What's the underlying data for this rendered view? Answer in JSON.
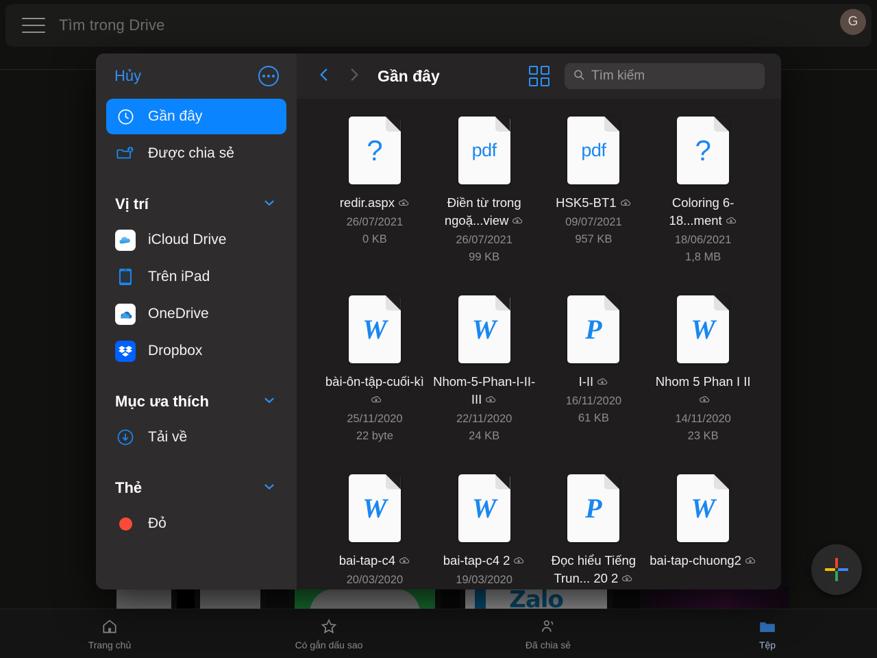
{
  "drive": {
    "search_placeholder": "Tìm trong Drive",
    "menu_icon": "hamburger-icon",
    "avatar_initial": "G",
    "fab_icon": "plus-icon",
    "tabs": [
      {
        "label": "Trang chủ",
        "icon": "home-icon",
        "active": false
      },
      {
        "label": "Có gắn dấu sao",
        "icon": "star-icon",
        "active": false
      },
      {
        "label": "Đã chia sẻ",
        "icon": "people-icon",
        "active": false
      },
      {
        "label": "Tệp",
        "icon": "folder-icon",
        "active": true
      }
    ]
  },
  "picker": {
    "cancel_label": "Hủy",
    "more_icon": "ellipsis-circle-icon",
    "nav": {
      "back_icon": "chevron-left-icon",
      "forward_icon": "chevron-right-icon",
      "breadcrumb": "Gần đây",
      "grid_icon": "grid-view-icon",
      "search_icon": "search-icon",
      "search_placeholder": "Tìm kiếm"
    },
    "sidebar": {
      "items": [
        {
          "label": "Gần đây",
          "icon": "clock-icon",
          "selected": true
        },
        {
          "label": "Được chia sẻ",
          "icon": "shared-folder-icon",
          "selected": false
        }
      ],
      "sections": [
        {
          "title": "Vị trí",
          "chevron": "chevron-down-icon",
          "items": [
            {
              "label": "iCloud Drive",
              "icon": "icloud-drive-icon"
            },
            {
              "label": "Trên iPad",
              "icon": "ipad-icon"
            },
            {
              "label": "OneDrive",
              "icon": "onedrive-icon"
            },
            {
              "label": "Dropbox",
              "icon": "dropbox-icon"
            }
          ]
        },
        {
          "title": "Mục ưa thích",
          "chevron": "chevron-down-icon",
          "items": [
            {
              "label": "Tải về",
              "icon": "download-circle-icon"
            }
          ]
        },
        {
          "title": "Thẻ",
          "chevron": "chevron-down-icon",
          "items": [
            {
              "label": "Đỏ",
              "icon": "red-dot-icon"
            }
          ]
        }
      ]
    },
    "files": [
      {
        "name": "redir.aspx",
        "kind": "unknown",
        "glyph": "?",
        "date": "26/07/2021",
        "size": "0 KB",
        "cloud": true
      },
      {
        "name": "Điền từ trong ngoặ...view",
        "kind": "pdf",
        "glyph": "pdf",
        "date": "26/07/2021",
        "size": "99 KB",
        "cloud": true
      },
      {
        "name": "HSK5-BT1",
        "kind": "pdf",
        "glyph": "pdf",
        "date": "09/07/2021",
        "size": "957 KB",
        "cloud": true
      },
      {
        "name": "Coloring 6-18...ment",
        "kind": "unknown",
        "glyph": "?",
        "date": "18/06/2021",
        "size": "1,8 MB",
        "cloud": true
      },
      {
        "name": "bài-ôn-tập-cuối-kì",
        "kind": "word",
        "glyph": "W",
        "date": "25/11/2020",
        "size": "22 byte",
        "cloud": true
      },
      {
        "name": "Nhom-5-Phan-I-II-III",
        "kind": "word",
        "glyph": "W",
        "date": "22/11/2020",
        "size": "24 KB",
        "cloud": true
      },
      {
        "name": "I-II",
        "kind": "powerpoint",
        "glyph": "P",
        "date": "16/11/2020",
        "size": "61 KB",
        "cloud": true
      },
      {
        "name": "Nhom 5 Phan I II",
        "kind": "word",
        "glyph": "W",
        "date": "14/11/2020",
        "size": "23 KB",
        "cloud": true
      },
      {
        "name": "bai-tap-c4",
        "kind": "word",
        "glyph": "W",
        "date": "20/03/2020",
        "size": "",
        "cloud": true
      },
      {
        "name": "bai-tap-c4 2",
        "kind": "word",
        "glyph": "W",
        "date": "19/03/2020",
        "size": "",
        "cloud": true
      },
      {
        "name": "Đọc hiểu Tiếng Trun... 20 2",
        "kind": "powerpoint",
        "glyph": "P",
        "date": "",
        "size": "",
        "cloud": true
      },
      {
        "name": "bai-tap-chuong2",
        "kind": "word",
        "glyph": "W",
        "date": "",
        "size": "",
        "cloud": true
      }
    ]
  },
  "colors": {
    "accent_blue": "#0a84ff",
    "link_blue": "#2e90fa",
    "tag_red": "#ff453a",
    "sidebar_bg": "#2e2c2c",
    "content_bg": "#1f1d1d"
  }
}
